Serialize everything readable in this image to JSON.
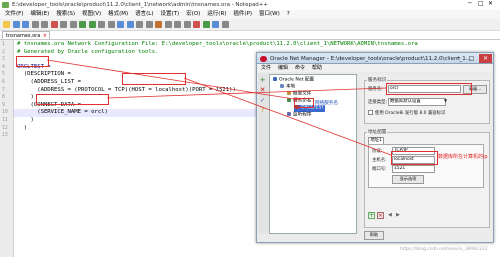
{
  "notepad": {
    "title": "E:\\developer_tools\\oracle\\product\\11.2.0\\client_1\\network\\admin\\tnsnames.ora - Notepad++",
    "menu": [
      "文件(F)",
      "编辑(E)",
      "搜索(S)",
      "视图(V)",
      "格式(M)",
      "语言(L)",
      "设置(T)",
      "宏(O)",
      "运行(R)",
      "插件(P)",
      "窗口(W)",
      "?"
    ],
    "tab_label": "tnsnames.ora",
    "code_lines": [
      {
        "n": "1",
        "text": "# tnsnames.ora Network Configuration File: E:\\developer_tools\\oracle\\product\\11.2.0\\client_1\\NETWORK\\ADMIN\\tnsnames.ora",
        "style": "comment"
      },
      {
        "n": "2",
        "text": "# Generated by Oracle configuration tools.",
        "style": "comment"
      },
      {
        "n": "3",
        "text": "",
        "style": "plain"
      },
      {
        "n": "4",
        "text": "ORCLTEST =",
        "style": "key"
      },
      {
        "n": "5",
        "text": "  (DESCRIPTION =",
        "style": "plain"
      },
      {
        "n": "6",
        "text": "    (ADDRESS_LIST =",
        "style": "plain"
      },
      {
        "n": "7",
        "text": "      (ADDRESS = (PROTOCOL = TCP)(HOST = localhost)(PORT = 1521))",
        "style": "plain"
      },
      {
        "n": "8",
        "text": "    )",
        "style": "plain"
      },
      {
        "n": "9",
        "text": "    (CONNECT_DATA =",
        "style": "plain"
      },
      {
        "n": "10",
        "text": "      (SERVICE_NAME = orcl)",
        "style": "plain"
      },
      {
        "n": "11",
        "text": "    )",
        "style": "plain"
      },
      {
        "n": "12",
        "text": "  )",
        "style": "plain"
      },
      {
        "n": "13",
        "text": "",
        "style": "plain"
      }
    ]
  },
  "net_manager": {
    "title": "Oracle Net Manager - E:\\developer_tools\\oracle\\product\\11.2.0\\client_1...",
    "menu": [
      "文件",
      "编辑",
      "命令",
      "帮助"
    ],
    "tree": [
      {
        "label": "Oracle Net 配置",
        "indent": 0
      },
      {
        "label": "本地",
        "indent": 1
      },
      {
        "label": "概要文件",
        "indent": 2
      },
      {
        "label": "服务命名",
        "indent": 2
      },
      {
        "label": "ORCLTEST",
        "indent": 3,
        "selected": true
      },
      {
        "label": "监听程序",
        "indent": 2
      }
    ],
    "tree_annotation": "网络服务名",
    "service_id": {
      "group_title": "服务标识",
      "service_name_label": "服务名:",
      "service_name_value": "orcl",
      "advanced_button": "高级...",
      "connection_type_label": "连接类型:",
      "connection_type_value": "数据库默认设置",
      "oracle8_option": "使用 Oracle8i 发行版 8.0 兼容标识"
    },
    "address_config": {
      "group_title": "地址配置",
      "tab_label": "地址1",
      "protocol_label": "协议:",
      "protocol_value": "TCP/IP",
      "host_label": "主机名:",
      "host_value": "localhost",
      "port_label": "端口号:",
      "port_value": "1521",
      "hide_button": "显示选项",
      "host_annotation": "数据库所在计算机的ip"
    },
    "help_button": "帮助"
  },
  "watermark": "https://blog.csdn.net/weixin_38962312"
}
